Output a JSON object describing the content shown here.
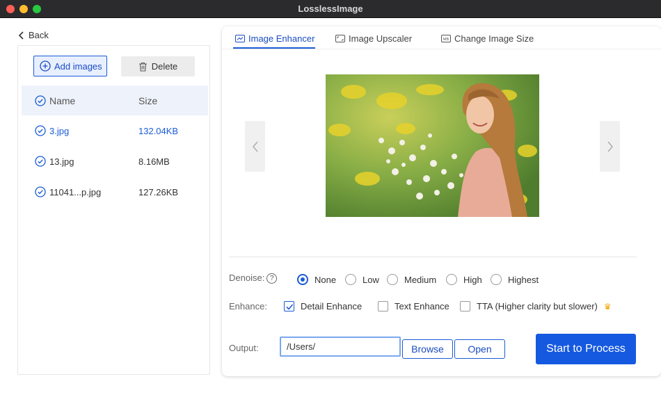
{
  "window": {
    "title": "LosslessImage"
  },
  "nav": {
    "back_label": "Back"
  },
  "file_panel": {
    "add_label": "Add images",
    "delete_label": "Delete",
    "headers": {
      "name": "Name",
      "size": "Size"
    },
    "files": [
      {
        "name": "3.jpg",
        "size": "132.04KB",
        "selected": true
      },
      {
        "name": "13.jpg",
        "size": "8.16MB",
        "selected": false
      },
      {
        "name": "11041...p.jpg",
        "size": "127.26KB",
        "selected": false
      }
    ]
  },
  "tabs": [
    {
      "label": "Image Enhancer",
      "icon": "enhance-icon",
      "active": true
    },
    {
      "label": "Image Upscaler",
      "icon": "upscale-icon",
      "active": false
    },
    {
      "label": "Change Image Size",
      "icon": "mb-icon",
      "active": false
    }
  ],
  "preview": {
    "description_icon": "photo-preview"
  },
  "denoise": {
    "label": "Denoise:",
    "help": "?",
    "options": [
      "None",
      "Low",
      "Medium",
      "High",
      "Highest"
    ],
    "selected": "None"
  },
  "enhance": {
    "label": "Enhance:",
    "options": [
      {
        "label": "Detail Enhance",
        "checked": true
      },
      {
        "label": "Text Enhance",
        "checked": false
      },
      {
        "label": "TTA  (Higher clarity but slower)",
        "checked": false
      }
    ]
  },
  "output": {
    "label": "Output:",
    "path": "/Users/",
    "browse_label": "Browse",
    "open_label": "Open",
    "start_label": "Start to Process"
  },
  "colors": {
    "accent": "#1a5bd6",
    "start_button": "#1559e0"
  }
}
